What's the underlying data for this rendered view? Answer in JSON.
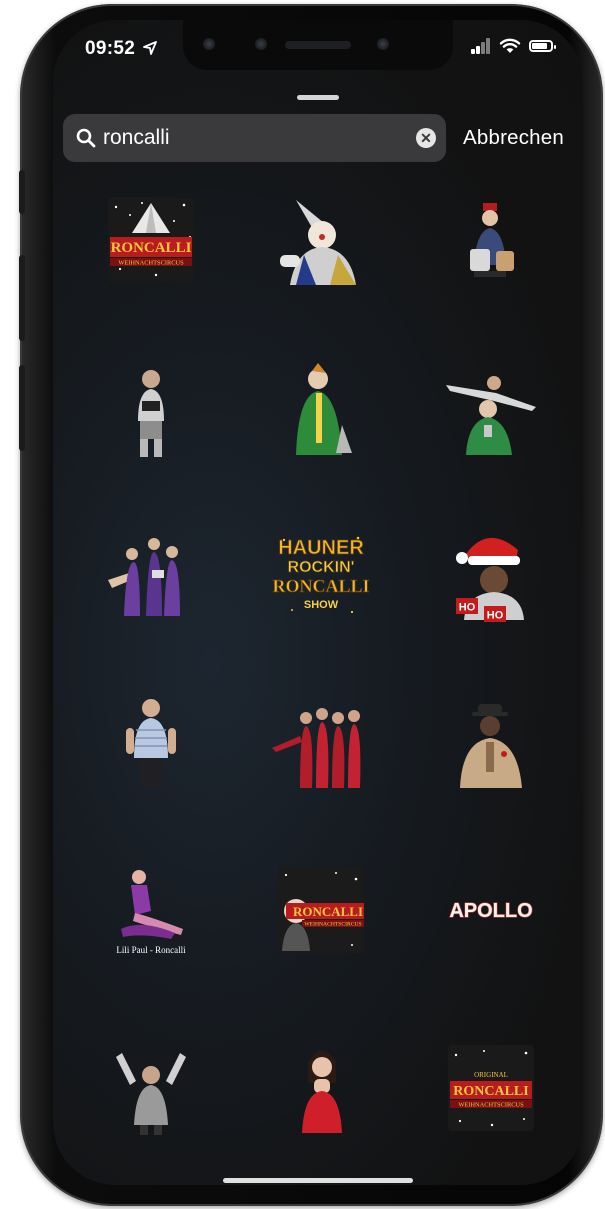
{
  "status_bar": {
    "time": "09:52"
  },
  "search": {
    "query": "roncalli",
    "clear_icon": "clear-circle-icon"
  },
  "cancel_label": "Abbrechen",
  "stickers": [
    {
      "name": "roncalli-weihnachtscircus-logo",
      "text1": "RONCALLI",
      "text2": "WEIHNACHTSCIRCUS"
    },
    {
      "name": "clown-pointed-hat-sticker"
    },
    {
      "name": "seated-clown-drum-sticker"
    },
    {
      "name": "clown-standing-sticker"
    },
    {
      "name": "green-clown-sticker"
    },
    {
      "name": "acrobat-on-clown-sticker"
    },
    {
      "name": "acrobat-trio-sticker"
    },
    {
      "name": "hauner-rockin-roncalli-show-logo",
      "text1": "HAUNER",
      "text2": "ROCKIN'",
      "text3": "RONCALLI",
      "text4": "SHOW"
    },
    {
      "name": "ho-ho-santa-sticker",
      "text1": "HO",
      "text2": "HO"
    },
    {
      "name": "man-striped-shirt-sticker"
    },
    {
      "name": "red-dancers-sticker"
    },
    {
      "name": "clown-bowler-hat-sticker"
    },
    {
      "name": "lili-paul-roncalli-sticker",
      "caption": "Lili Paul - Roncalli"
    },
    {
      "name": "roncalli-weihnachtscircus-clown-logo",
      "text1": "RONCALLI",
      "text2": "WEIHNACHTSCIRCUS"
    },
    {
      "name": "apollo-logo",
      "text1": "APOLLO"
    },
    {
      "name": "man-hands-up-sticker"
    },
    {
      "name": "woman-blowing-kiss-sticker"
    },
    {
      "name": "original-roncalli-weihnachtscircus-logo",
      "text1": "ORIGINAL",
      "text2": "RONCALLI",
      "text3": "WEIHNACHTSCIRCUS"
    }
  ]
}
